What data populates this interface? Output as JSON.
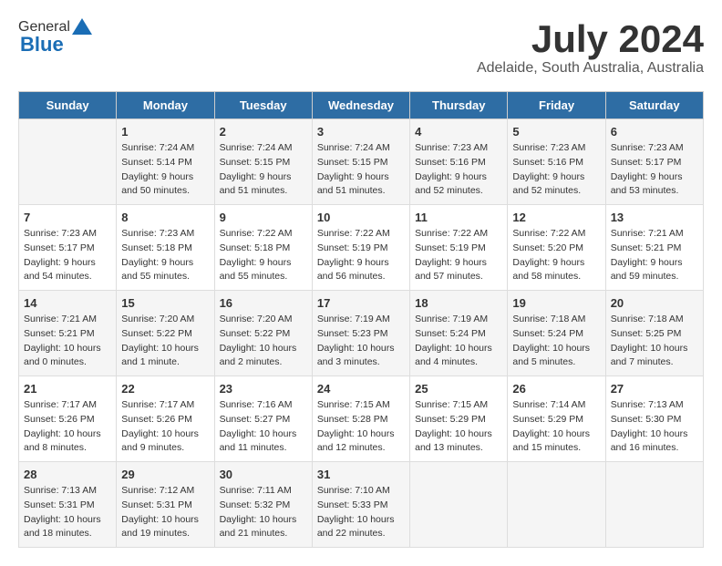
{
  "header": {
    "logo_general": "General",
    "logo_blue": "Blue",
    "main_title": "July 2024",
    "subtitle": "Adelaide, South Australia, Australia"
  },
  "calendar": {
    "days_of_week": [
      "Sunday",
      "Monday",
      "Tuesday",
      "Wednesday",
      "Thursday",
      "Friday",
      "Saturday"
    ],
    "weeks": [
      [
        {
          "day": "",
          "info": ""
        },
        {
          "day": "1",
          "info": "Sunrise: 7:24 AM\nSunset: 5:14 PM\nDaylight: 9 hours\nand 50 minutes."
        },
        {
          "day": "2",
          "info": "Sunrise: 7:24 AM\nSunset: 5:15 PM\nDaylight: 9 hours\nand 51 minutes."
        },
        {
          "day": "3",
          "info": "Sunrise: 7:24 AM\nSunset: 5:15 PM\nDaylight: 9 hours\nand 51 minutes."
        },
        {
          "day": "4",
          "info": "Sunrise: 7:23 AM\nSunset: 5:16 PM\nDaylight: 9 hours\nand 52 minutes."
        },
        {
          "day": "5",
          "info": "Sunrise: 7:23 AM\nSunset: 5:16 PM\nDaylight: 9 hours\nand 52 minutes."
        },
        {
          "day": "6",
          "info": "Sunrise: 7:23 AM\nSunset: 5:17 PM\nDaylight: 9 hours\nand 53 minutes."
        }
      ],
      [
        {
          "day": "7",
          "info": "Sunrise: 7:23 AM\nSunset: 5:17 PM\nDaylight: 9 hours\nand 54 minutes."
        },
        {
          "day": "8",
          "info": "Sunrise: 7:23 AM\nSunset: 5:18 PM\nDaylight: 9 hours\nand 55 minutes."
        },
        {
          "day": "9",
          "info": "Sunrise: 7:22 AM\nSunset: 5:18 PM\nDaylight: 9 hours\nand 55 minutes."
        },
        {
          "day": "10",
          "info": "Sunrise: 7:22 AM\nSunset: 5:19 PM\nDaylight: 9 hours\nand 56 minutes."
        },
        {
          "day": "11",
          "info": "Sunrise: 7:22 AM\nSunset: 5:19 PM\nDaylight: 9 hours\nand 57 minutes."
        },
        {
          "day": "12",
          "info": "Sunrise: 7:22 AM\nSunset: 5:20 PM\nDaylight: 9 hours\nand 58 minutes."
        },
        {
          "day": "13",
          "info": "Sunrise: 7:21 AM\nSunset: 5:21 PM\nDaylight: 9 hours\nand 59 minutes."
        }
      ],
      [
        {
          "day": "14",
          "info": "Sunrise: 7:21 AM\nSunset: 5:21 PM\nDaylight: 10 hours\nand 0 minutes."
        },
        {
          "day": "15",
          "info": "Sunrise: 7:20 AM\nSunset: 5:22 PM\nDaylight: 10 hours\nand 1 minute."
        },
        {
          "day": "16",
          "info": "Sunrise: 7:20 AM\nSunset: 5:22 PM\nDaylight: 10 hours\nand 2 minutes."
        },
        {
          "day": "17",
          "info": "Sunrise: 7:19 AM\nSunset: 5:23 PM\nDaylight: 10 hours\nand 3 minutes."
        },
        {
          "day": "18",
          "info": "Sunrise: 7:19 AM\nSunset: 5:24 PM\nDaylight: 10 hours\nand 4 minutes."
        },
        {
          "day": "19",
          "info": "Sunrise: 7:18 AM\nSunset: 5:24 PM\nDaylight: 10 hours\nand 5 minutes."
        },
        {
          "day": "20",
          "info": "Sunrise: 7:18 AM\nSunset: 5:25 PM\nDaylight: 10 hours\nand 7 minutes."
        }
      ],
      [
        {
          "day": "21",
          "info": "Sunrise: 7:17 AM\nSunset: 5:26 PM\nDaylight: 10 hours\nand 8 minutes."
        },
        {
          "day": "22",
          "info": "Sunrise: 7:17 AM\nSunset: 5:26 PM\nDaylight: 10 hours\nand 9 minutes."
        },
        {
          "day": "23",
          "info": "Sunrise: 7:16 AM\nSunset: 5:27 PM\nDaylight: 10 hours\nand 11 minutes."
        },
        {
          "day": "24",
          "info": "Sunrise: 7:15 AM\nSunset: 5:28 PM\nDaylight: 10 hours\nand 12 minutes."
        },
        {
          "day": "25",
          "info": "Sunrise: 7:15 AM\nSunset: 5:29 PM\nDaylight: 10 hours\nand 13 minutes."
        },
        {
          "day": "26",
          "info": "Sunrise: 7:14 AM\nSunset: 5:29 PM\nDaylight: 10 hours\nand 15 minutes."
        },
        {
          "day": "27",
          "info": "Sunrise: 7:13 AM\nSunset: 5:30 PM\nDaylight: 10 hours\nand 16 minutes."
        }
      ],
      [
        {
          "day": "28",
          "info": "Sunrise: 7:13 AM\nSunset: 5:31 PM\nDaylight: 10 hours\nand 18 minutes."
        },
        {
          "day": "29",
          "info": "Sunrise: 7:12 AM\nSunset: 5:31 PM\nDaylight: 10 hours\nand 19 minutes."
        },
        {
          "day": "30",
          "info": "Sunrise: 7:11 AM\nSunset: 5:32 PM\nDaylight: 10 hours\nand 21 minutes."
        },
        {
          "day": "31",
          "info": "Sunrise: 7:10 AM\nSunset: 5:33 PM\nDaylight: 10 hours\nand 22 minutes."
        },
        {
          "day": "",
          "info": ""
        },
        {
          "day": "",
          "info": ""
        },
        {
          "day": "",
          "info": ""
        }
      ]
    ]
  }
}
